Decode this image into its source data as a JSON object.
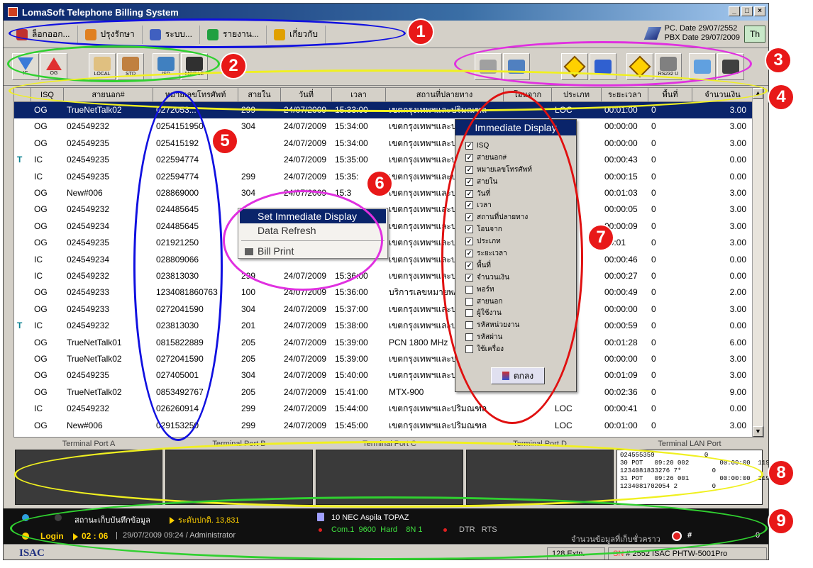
{
  "window": {
    "title": "LomaSoft Telephone Billing System",
    "colors": {
      "title_bar": "#0a246a",
      "selected_row": "#0a246a"
    }
  },
  "menu": {
    "items": [
      {
        "label": "ล็อกออก...",
        "icon": "key-icon",
        "color": "#c03030"
      },
      {
        "label": "ปรุงรักษา",
        "icon": "tools-icon",
        "color": "#e08020"
      },
      {
        "label": "ระบบ...",
        "icon": "system-icon",
        "color": "#4060c0"
      },
      {
        "label": "รายงาน...",
        "icon": "report-icon",
        "color": "#20a040"
      },
      {
        "label": "เกี่ยวกับ",
        "icon": "home-icon",
        "color": "#e0a000"
      }
    ],
    "pc_date_label": "PC. Date",
    "pc_date": "29/07/2552",
    "pbx_date_label": "PBX Date",
    "pbx_date": "29/07/2009",
    "language": "Th"
  },
  "toolbar": {
    "left": [
      {
        "label": "IC",
        "icon": "incoming-arrow-icon"
      },
      {
        "label": "OG",
        "icon": "outgoing-arrow-icon"
      },
      {
        "label": "LOCAL",
        "icon": "local-phone-icon"
      },
      {
        "label": "STD",
        "icon": "std-phone-icon"
      },
      {
        "label": "ISD",
        "icon": "isd-computer-icon"
      },
      {
        "label": "MOBILE",
        "icon": "mobile-phone-icon"
      }
    ],
    "right": [
      {
        "label": "",
        "icon": "circle-settings-icon"
      },
      {
        "label": "",
        "icon": "monitor-icon"
      },
      {
        "label": "",
        "icon": "diamond-arrow-icon"
      },
      {
        "label": "",
        "icon": "display-icon"
      },
      {
        "label": "",
        "icon": "diamond-arrow-icon"
      },
      {
        "label": "RS232 U",
        "icon": "serial-port-icon"
      },
      {
        "label": "",
        "icon": "note-icon"
      },
      {
        "label": "",
        "icon": "printer-icon"
      }
    ]
  },
  "table": {
    "columns": [
      "ISQ",
      "สายนอก#",
      "หมายเลขโทรศัพท์",
      "สายใน",
      "วันที่",
      "เวลา",
      "สถานที่ปลายทาง",
      "โอนจาก",
      "ประเภท",
      "ระยะเวลา",
      "พื้นที่",
      "จำนวนเงิน"
    ],
    "rows": [
      {
        "flag": "",
        "isq": "OG",
        "trunk": "TrueNetTalk02",
        "phone": "0272053...",
        "ext": "299",
        "date": "24/07/2009",
        "time": "15:33:00",
        "dest": "เขตกรุงเทพฯและปริมณฑล",
        "from": "",
        "type": "LOC",
        "dur": "00:01:00",
        "area": "0",
        "amount": "3.00",
        "selected": true
      },
      {
        "flag": "",
        "isq": "OG",
        "trunk": "024549232",
        "phone": "0254151950",
        "ext": "304",
        "date": "24/07/2009",
        "time": "15:34:00",
        "dest": "เขตกรุงเทพฯและป",
        "from": "",
        "type": "",
        "dur": "00:00:00",
        "area": "0",
        "amount": "3.00"
      },
      {
        "flag": "",
        "isq": "OG",
        "trunk": "024549235",
        "phone": "025415192",
        "ext": "",
        "date": "24/07/2009",
        "time": "15:34:00",
        "dest": "เขตกรุงเทพฯและป",
        "from": "",
        "type": "",
        "dur": "00:00:00",
        "area": "0",
        "amount": "3.00"
      },
      {
        "flag": "T",
        "isq": "IC",
        "trunk": "024549235",
        "phone": "022594774",
        "ext": "",
        "date": "24/07/2009",
        "time": "15:35:00",
        "dest": "เขตกรุงเทพฯและป",
        "from": "",
        "type": "",
        "dur": "00:00:43",
        "area": "0",
        "amount": "0.00"
      },
      {
        "flag": "",
        "isq": "IC",
        "trunk": "024549235",
        "phone": "022594774",
        "ext": "299",
        "date": "24/07/2009",
        "time": "15:35:",
        "dest": "เขตกรุงเทพฯและป",
        "from": "",
        "type": "",
        "dur": "00:00:15",
        "area": "0",
        "amount": "0.00"
      },
      {
        "flag": "",
        "isq": "OG",
        "trunk": "New#006",
        "phone": "028869000",
        "ext": "304",
        "date": "24/07/2009",
        "time": "15:3",
        "dest": "เขตกรุงเทพฯและป",
        "from": "",
        "type": "",
        "dur": "00:01:03",
        "area": "0",
        "amount": "3.00"
      },
      {
        "flag": "",
        "isq": "OG",
        "trunk": "024549232",
        "phone": "024485645",
        "ext": "",
        "date": "",
        "time": "",
        "dest": "เขตกรุงเทพฯและป",
        "from": "",
        "type": "",
        "dur": "00:00:05",
        "area": "0",
        "amount": "3.00"
      },
      {
        "flag": "",
        "isq": "OG",
        "trunk": "024549234",
        "phone": "024485645",
        "ext": "",
        "date": "",
        "time": "",
        "dest": "เขตกรุงเทพฯและป",
        "from": "",
        "type": "",
        "dur": "00:00:09",
        "area": "0",
        "amount": "3.00"
      },
      {
        "flag": "",
        "isq": "OG",
        "trunk": "024549235",
        "phone": "021921250",
        "ext": "",
        "date": "",
        "time": "",
        "dest": "เขตกรุงเทพฯและป",
        "from": "",
        "type": "",
        "dur": "00:01",
        "area": "0",
        "amount": "3.00"
      },
      {
        "flag": "",
        "isq": "IC",
        "trunk": "024549234",
        "phone": "028809066",
        "ext": "",
        "date": "",
        "time": "",
        "dest": "เขตกรุงเทพฯและป",
        "from": "",
        "type": "",
        "dur": "00:00:46",
        "area": "0",
        "amount": "0.00"
      },
      {
        "flag": "",
        "isq": "IC",
        "trunk": "024549232",
        "phone": "023813030",
        "ext": "299",
        "date": "24/07/2009",
        "time": "15:36:00",
        "dest": "เขตกรุงเทพฯและป",
        "from": "",
        "type": "",
        "dur": "00:00:27",
        "area": "0",
        "amount": "0.00"
      },
      {
        "flag": "",
        "isq": "OG",
        "trunk": "024549233",
        "phone": "1234081860763",
        "ext": "100",
        "date": "24/07/2009",
        "time": "15:36:00",
        "dest": "บริการเลขหมายพ/",
        "from": "",
        "type": "",
        "dur": "00:00:49",
        "area": "0",
        "amount": "2.00"
      },
      {
        "flag": "",
        "isq": "OG",
        "trunk": "024549233",
        "phone": "0272041590",
        "ext": "304",
        "date": "24/07/2009",
        "time": "15:37:00",
        "dest": "เขตกรุงเทพฯและป",
        "from": "",
        "type": "",
        "dur": "00:00:00",
        "area": "0",
        "amount": "3.00"
      },
      {
        "flag": "T",
        "isq": "IC",
        "trunk": "024549232",
        "phone": "023813030",
        "ext": "201",
        "date": "24/07/2009",
        "time": "15:38:00",
        "dest": "เขตกรุงเทพฯและป",
        "from": "",
        "type": "",
        "dur": "00:00:59",
        "area": "0",
        "amount": "0.00"
      },
      {
        "flag": "",
        "isq": "OG",
        "trunk": "TrueNetTalk01",
        "phone": "0815822889",
        "ext": "205",
        "date": "24/07/2009",
        "time": "15:39:00",
        "dest": "PCN 1800 MHz",
        "from": "",
        "type": "",
        "dur": "00:01:28",
        "area": "0",
        "amount": "6.00"
      },
      {
        "flag": "",
        "isq": "OG",
        "trunk": "TrueNetTalk02",
        "phone": "0272041590",
        "ext": "205",
        "date": "24/07/2009",
        "time": "15:39:00",
        "dest": "เขตกรุงเทพฯและป",
        "from": "",
        "type": "",
        "dur": "00:00:00",
        "area": "0",
        "amount": "3.00"
      },
      {
        "flag": "",
        "isq": "OG",
        "trunk": "024549235",
        "phone": "027405001",
        "ext": "304",
        "date": "24/07/2009",
        "time": "15:40:00",
        "dest": "เขตกรุงเทพฯและป",
        "from": "",
        "type": "",
        "dur": "00:01:09",
        "area": "0",
        "amount": "3.00"
      },
      {
        "flag": "",
        "isq": "OG",
        "trunk": "TrueNetTalk02",
        "phone": "0853492767",
        "ext": "205",
        "date": "24/07/2009",
        "time": "15:41:00",
        "dest": "MTX-900",
        "from": "",
        "type": "",
        "dur": "00:02:36",
        "area": "0",
        "amount": "9.00"
      },
      {
        "flag": "",
        "isq": "IC",
        "trunk": "024549232",
        "phone": "026260914",
        "ext": "299",
        "date": "24/07/2009",
        "time": "15:44:00",
        "dest": "เขตกรุงเทพฯและปริมณฑล",
        "from": "",
        "type": "LOC",
        "dur": "00:00:41",
        "area": "0",
        "amount": "0.00"
      },
      {
        "flag": "",
        "isq": "OG",
        "trunk": "New#006",
        "phone": "029153250",
        "ext": "299",
        "date": "24/07/2009",
        "time": "15:45:00",
        "dest": "เขตกรุงเทพฯและปริมณฑล",
        "from": "",
        "type": "LOC",
        "dur": "00:01:00",
        "area": "0",
        "amount": "3.00"
      }
    ]
  },
  "immediate_display": {
    "title": "Immediate Display",
    "options": [
      {
        "label": "ISQ",
        "checked": true
      },
      {
        "label": "สายนอก#",
        "checked": true
      },
      {
        "label": "หมายเลขโทรศัพท์",
        "checked": true
      },
      {
        "label": "สายใน",
        "checked": true
      },
      {
        "label": "วันที่",
        "checked": true
      },
      {
        "label": "เวลา",
        "checked": true
      },
      {
        "label": "สถานที่ปลายทาง",
        "checked": true
      },
      {
        "label": "โอนจาก",
        "checked": true
      },
      {
        "label": "ประเภท",
        "checked": true
      },
      {
        "label": "ระยะเวลา",
        "checked": true
      },
      {
        "label": "พื้นที่",
        "checked": true
      },
      {
        "label": "จำนวนเงิน",
        "checked": true
      },
      {
        "label": "พอร์ท",
        "checked": false
      },
      {
        "label": "สายนอก",
        "checked": false
      },
      {
        "label": "ผู้ใช้งาน",
        "checked": false
      },
      {
        "label": "รหัสหน่วยงาน",
        "checked": false
      },
      {
        "label": "รหัสผ่าน",
        "checked": false
      },
      {
        "label": "ใช้เครื่อง",
        "checked": false
      }
    ],
    "ok_label": "ตกลง"
  },
  "context_menu": {
    "items": [
      "Set Immediate Display",
      "Data Refresh",
      "Bill Print"
    ]
  },
  "terminals": {
    "ports": [
      "Terminal Port A",
      "Terminal Port B",
      "Terminal Port C",
      "Terminal Port D",
      "Terminal LAN Port"
    ],
    "lan_lines": [
      "024555359             0",
      "30 POT   09:20 002        00:00:00  119",
      "1234081833276 7*        0",
      "31 POT   09:26 001        00:00:00  119",
      "1234081702054 2         0"
    ]
  },
  "status": {
    "storage_label": "สถานะเก็บบันทึกข้อมูล",
    "storage_value": "ระดับปกติ. 13,831",
    "login_label": "Login",
    "login_timer": "02 : 06",
    "login_info": "29/07/2009 09:24 / Administrator",
    "pbx_model": "10 NEC Aspila TOPAZ",
    "com_settings": [
      "Com.1",
      "9600",
      "Hard",
      "8N 1"
    ],
    "signals": [
      "DTR",
      "RTS"
    ],
    "pending_label": "จำนวนข้อมูลที่เก็บชั่วคราว",
    "pending_value": "#",
    "pending_count": "0"
  },
  "footer": {
    "brand": "ISAC",
    "extn": "128 Extn.",
    "sn_label": "SN",
    "sn_value": "# 2552 ISAC PHTW-5001Pro"
  },
  "annotations": [
    "1",
    "2",
    "3",
    "4",
    "5",
    "6",
    "7",
    "8",
    "9"
  ]
}
